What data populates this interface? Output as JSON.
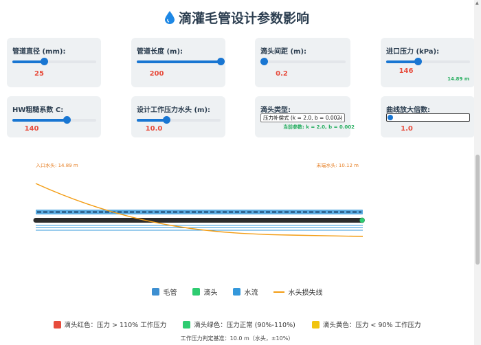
{
  "header": {
    "title": "滴灌毛管设计参数影响"
  },
  "params": {
    "diameter": {
      "label": "管道直径 (mm):",
      "value": "25",
      "fraction": 0.38
    },
    "length": {
      "label": "管道长度 (m):",
      "value": "200",
      "fraction": 1.0
    },
    "spacing": {
      "label": "滴头间距 (m):",
      "value": "0.2",
      "fraction": 0.04
    },
    "inlet": {
      "label": "进口压力 (kPa):",
      "value": "146",
      "fraction": 0.38,
      "note": "14.89 m"
    },
    "roughness": {
      "label": "HW粗糙系数 C:",
      "value": "140",
      "fraction": 0.65
    },
    "work_head": {
      "label": "设计工作压力水头 (m):",
      "value": "10.0",
      "fraction": 0.35
    },
    "emitter": {
      "label": "滴头类型:",
      "selected": "压力补偿式 (k = 2.0, b = 0.002)",
      "note": "当前参数: k = 2.0, b = 0.002"
    },
    "magnify": {
      "label": "曲线放大倍数:",
      "value": "1.0",
      "fraction": 0.0
    }
  },
  "viz": {
    "inlet_label": "入口水头: 14.89 m",
    "end_label": "末端水头: 10.12 m",
    "inlet_head_m": 14.89,
    "end_head_m": 10.12,
    "colors": {
      "pipe": "#2c2c2c",
      "emitter_dash": "#5dade2",
      "water": "#3498db",
      "curve": "#f39c12",
      "end_dot": "#2ecc71"
    }
  },
  "legend": {
    "pipe": "毛管",
    "emitter": "滴头",
    "flow": "水流",
    "head_loss": "水头损失线",
    "colors": {
      "pipe": "#3d8fd1",
      "emitter": "#2ecc71",
      "flow": "#3498db",
      "head_loss": "#f39c12"
    }
  },
  "status": {
    "red": "滴头红色：压力 > 110% 工作压力",
    "green": "滴头绿色：压力正常 (90%-110%)",
    "yellow": "滴头黄色：压力 < 90% 工作压力",
    "basis": "工作压力判定基准：10.0 m（水头，±10%）",
    "colors": {
      "red": "#e74c3c",
      "green": "#2ecc71",
      "yellow": "#f1c40f"
    }
  }
}
